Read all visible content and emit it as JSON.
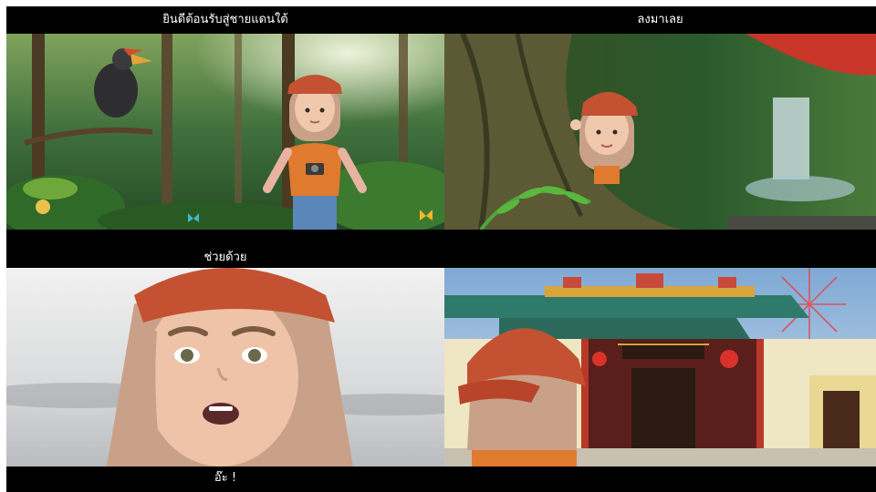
{
  "captions": {
    "panel1": "ยินดีต้อนรับสู่ชายแดนใต้",
    "panel2": "ลงมาเลย",
    "panel3": "ช่วยด้วย",
    "panel3_bottom": "อ๊ะ !"
  },
  "colors": {
    "background": "#ffffff",
    "letterbox": "#000000",
    "hair": "#c9a188",
    "cap": "#c45232",
    "shirt": "#e07a2f"
  }
}
